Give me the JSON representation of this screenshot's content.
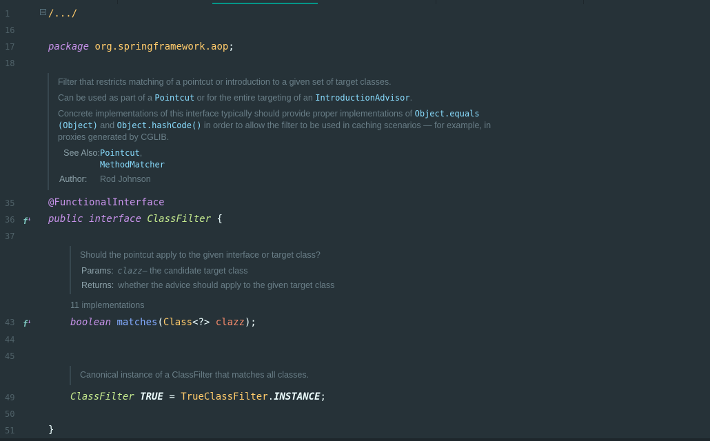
{
  "line_numbers": [
    "1",
    "16",
    "17",
    "18",
    "35",
    "36",
    "37",
    "43",
    "44",
    "45",
    "49",
    "50",
    "51"
  ],
  "fold_text": "/.../",
  "package_line": {
    "keyword": "package",
    "name": "org.springframework.aop",
    "semicolon": ";"
  },
  "class_doc": {
    "p1": "Filter that restricts matching of a pointcut or introduction to a given set of target classes.",
    "p2_a": "Can be used as part of a ",
    "p2_link1": "Pointcut",
    "p2_b": " or for the entire targeting of an ",
    "p2_link2": "IntroductionAdvisor",
    "p2_c": ".",
    "p3_a": "Concrete implementations of this interface typically should provide proper implementations of ",
    "p3_code1": "Object.equals",
    "p3_code2": "(Object)",
    "p3_b": " and ",
    "p3_code3": "Object.hashCode()",
    "p3_c": " in order to allow the filter to be used in caching scenarios — for example, in",
    "p3_d": "proxies generated by CGLIB.",
    "see_also_label": "See Also:",
    "see_also_1": "Pointcut",
    "see_also_1_sep": ",",
    "see_also_2": "MethodMatcher",
    "author_label": "Author:",
    "author": "Rod Johnson"
  },
  "annotation": "@FunctionalInterface",
  "decl": {
    "public": "public",
    "interface": "interface",
    "name": "ClassFilter",
    "brace": "{"
  },
  "method_doc": {
    "summary": "Should the pointcut apply to the given interface or target class?",
    "params_label": "Params:",
    "param_name": "clazz",
    "param_desc": " – the candidate target class",
    "returns_label": "Returns:",
    "returns_desc": "whether the advice should apply to the given target class"
  },
  "implementations": "11 implementations",
  "method": {
    "ret": "boolean",
    "name": "matches",
    "open": "(",
    "ptype": "Class",
    "generic": "<?>",
    "pname": "clazz",
    "close": ");"
  },
  "field_doc": "Canonical instance of a ClassFilter that matches all classes.",
  "field": {
    "type": "ClassFilter",
    "name": "TRUE",
    "eq": "=",
    "impl": "TrueClassFilter",
    "dot": ".",
    "member": "INSTANCE",
    "semi": ";"
  },
  "closing_brace": "}",
  "gutter_icon": "implemented-interface-icon",
  "colors": {
    "background": "#263238",
    "accent": "#009688",
    "keyword": "#c792ea",
    "string_type": "#ffcb6b",
    "class": "#c3e88d"
  }
}
